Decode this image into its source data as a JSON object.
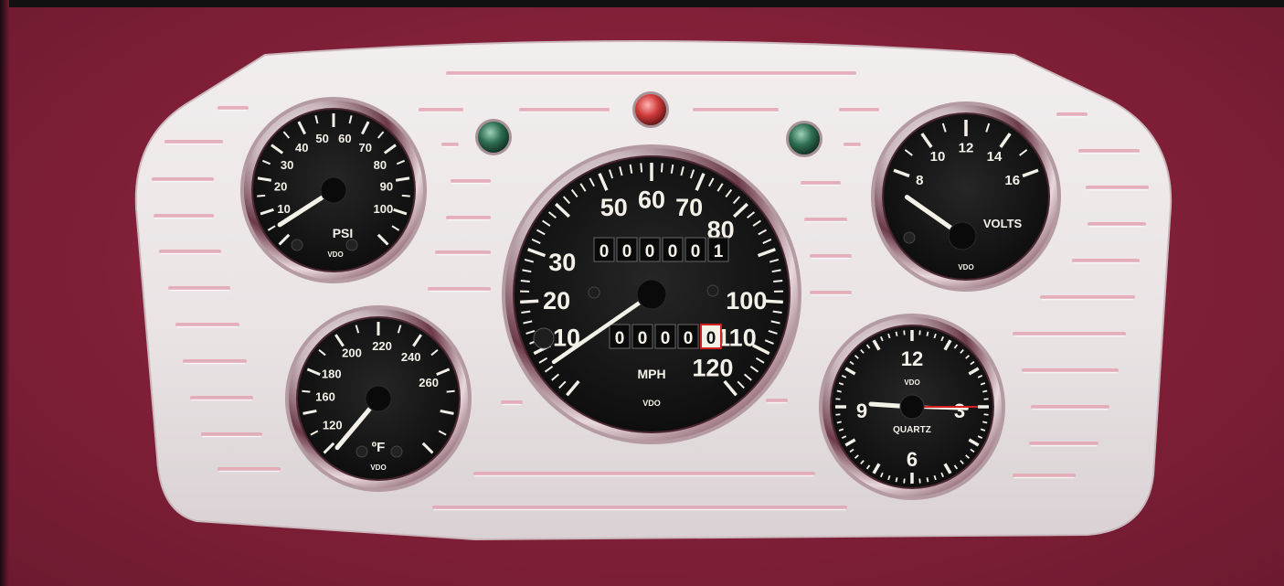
{
  "gauges": {
    "oil_pressure": {
      "labels": [
        "10",
        "20",
        "30",
        "40",
        "50",
        "60",
        "70",
        "80",
        "90",
        "100"
      ],
      "unit": "PSI",
      "brand": "VDO",
      "needle_value": 5
    },
    "speedometer": {
      "labels": [
        "10",
        "20",
        "30",
        "50",
        "60",
        "70",
        "80",
        "100",
        "110",
        "120"
      ],
      "unit": "MPH",
      "brand": "VDO",
      "odometer": "000001",
      "trip": "00000",
      "needle_value": 10
    },
    "voltmeter": {
      "labels": [
        "8",
        "10",
        "12",
        "14",
        "16"
      ],
      "unit": "VOLTS",
      "brand": "VDO",
      "needle_value": 8
    },
    "temperature": {
      "labels": [
        "120",
        "160",
        "180",
        "200",
        "220",
        "240",
        "260"
      ],
      "unit": "ºF",
      "brand": "VDO",
      "needle_value": 120
    },
    "clock": {
      "labels": [
        "12",
        "3",
        "6",
        "9"
      ],
      "brand_small": "VDO",
      "unit": "QUARTZ",
      "time": "9:15"
    }
  },
  "indicators": [
    {
      "name": "left",
      "color": "#2f6e52"
    },
    {
      "name": "center",
      "color": "#d03b3b"
    },
    {
      "name": "right",
      "color": "#2f6e52"
    }
  ],
  "colors": {
    "background": "#86213a",
    "panel": "#ece6e7",
    "groove": "#e3a6b4",
    "dial": "#151515",
    "needle": "#f4f1e8",
    "clock_second_hand": "#d62020"
  }
}
